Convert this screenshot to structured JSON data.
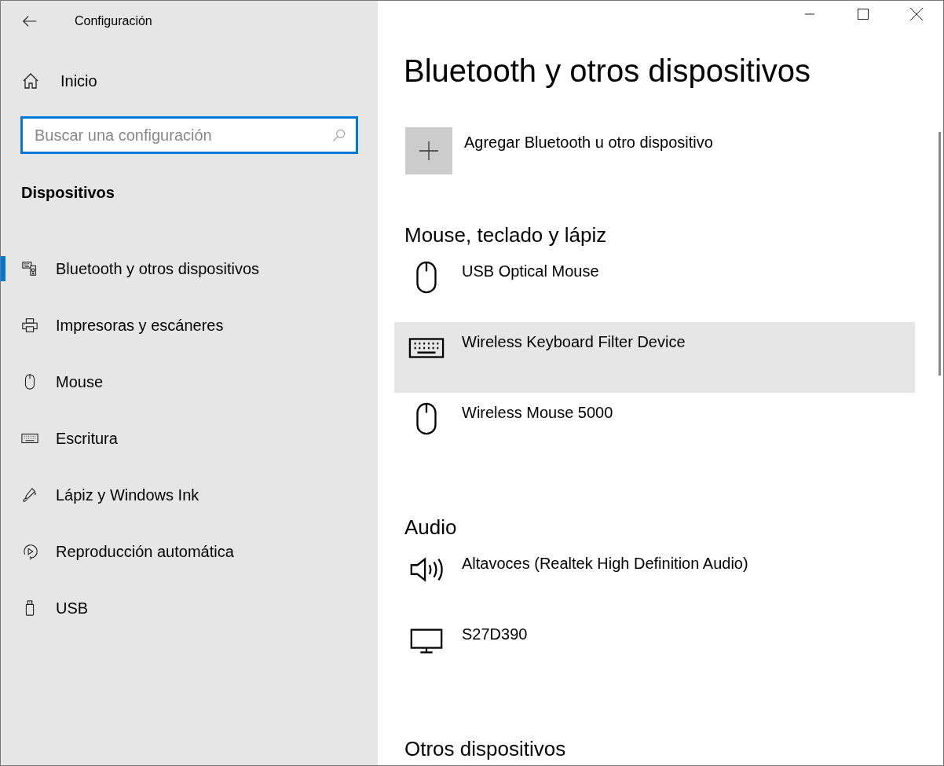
{
  "window": {
    "title": "Configuración"
  },
  "home": {
    "label": "Inicio"
  },
  "search": {
    "placeholder": "Buscar una configuración"
  },
  "sidebar": {
    "heading": "Dispositivos",
    "items": [
      {
        "label": "Bluetooth y otros dispositivos",
        "kind": "bluetooth",
        "selected": true
      },
      {
        "label": "Impresoras y escáneres",
        "kind": "printer",
        "selected": false
      },
      {
        "label": "Mouse",
        "kind": "mouse",
        "selected": false
      },
      {
        "label": "Escritura",
        "kind": "keyboard",
        "selected": false
      },
      {
        "label": "Lápiz y Windows Ink",
        "kind": "pen",
        "selected": false
      },
      {
        "label": "Reproducción automática",
        "kind": "autoplay",
        "selected": false
      },
      {
        "label": "USB",
        "kind": "usb",
        "selected": false
      }
    ]
  },
  "page": {
    "title": "Bluetooth y otros dispositivos",
    "add_button": {
      "label": "Agregar Bluetooth u otro dispositivo"
    },
    "sections": [
      {
        "heading": "Mouse, teclado y lápiz",
        "devices": [
          {
            "name": "USB Optical Mouse",
            "kind": "mouse",
            "selected": false
          },
          {
            "name": "Wireless Keyboard Filter Device",
            "kind": "keyboard",
            "selected": true
          },
          {
            "name": "Wireless Mouse 5000",
            "kind": "mouse",
            "selected": false
          }
        ]
      },
      {
        "heading": "Audio",
        "devices": [
          {
            "name": "Altavoces (Realtek High Definition Audio)",
            "kind": "speaker",
            "selected": false
          },
          {
            "name": "S27D390",
            "kind": "monitor",
            "selected": false
          }
        ]
      },
      {
        "heading": "Otros dispositivos"
      }
    ]
  }
}
